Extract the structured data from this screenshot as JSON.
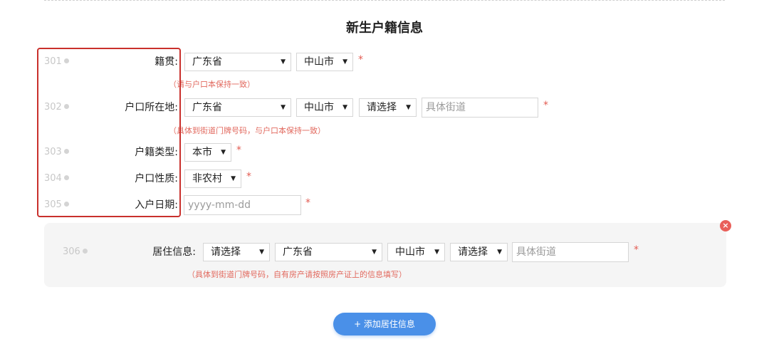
{
  "page_title": "新生户籍信息",
  "required_mark": "*",
  "select_arrow": "▼",
  "dot_color": "#d4d4d4",
  "rows": {
    "r301": {
      "num": "301",
      "label": "籍贯:",
      "province": "广东省",
      "city": "中山市",
      "hint": "（请与户口本保持一致）"
    },
    "r302": {
      "num": "302",
      "label": "户口所在地:",
      "province": "广东省",
      "city": "中山市",
      "district": "请选择",
      "street_placeholder": "具体街道",
      "hint": "（具体到街道门牌号码，与户口本保持一致）"
    },
    "r303": {
      "num": "303",
      "label": "户籍类型:",
      "value": "本市"
    },
    "r304": {
      "num": "304",
      "label": "户口性质:",
      "value": "非农村"
    },
    "r305": {
      "num": "305",
      "label": "入户日期:",
      "date_placeholder": "yyyy-mm-dd"
    }
  },
  "residence": {
    "num": "306",
    "label": "居住信息:",
    "type": "请选择",
    "province": "广东省",
    "city": "中山市",
    "district": "请选择",
    "street_placeholder": "具体街道",
    "hint": "（具体到街道门牌号码，自有房产请按照房产证上的信息填写）",
    "remove_icon": "×"
  },
  "add_button": "+ 添加居住信息",
  "colors": {
    "accent": "#4a90e8",
    "highlight": "#c9302c",
    "required": "#e35c52",
    "hint": "#e26a5f"
  }
}
